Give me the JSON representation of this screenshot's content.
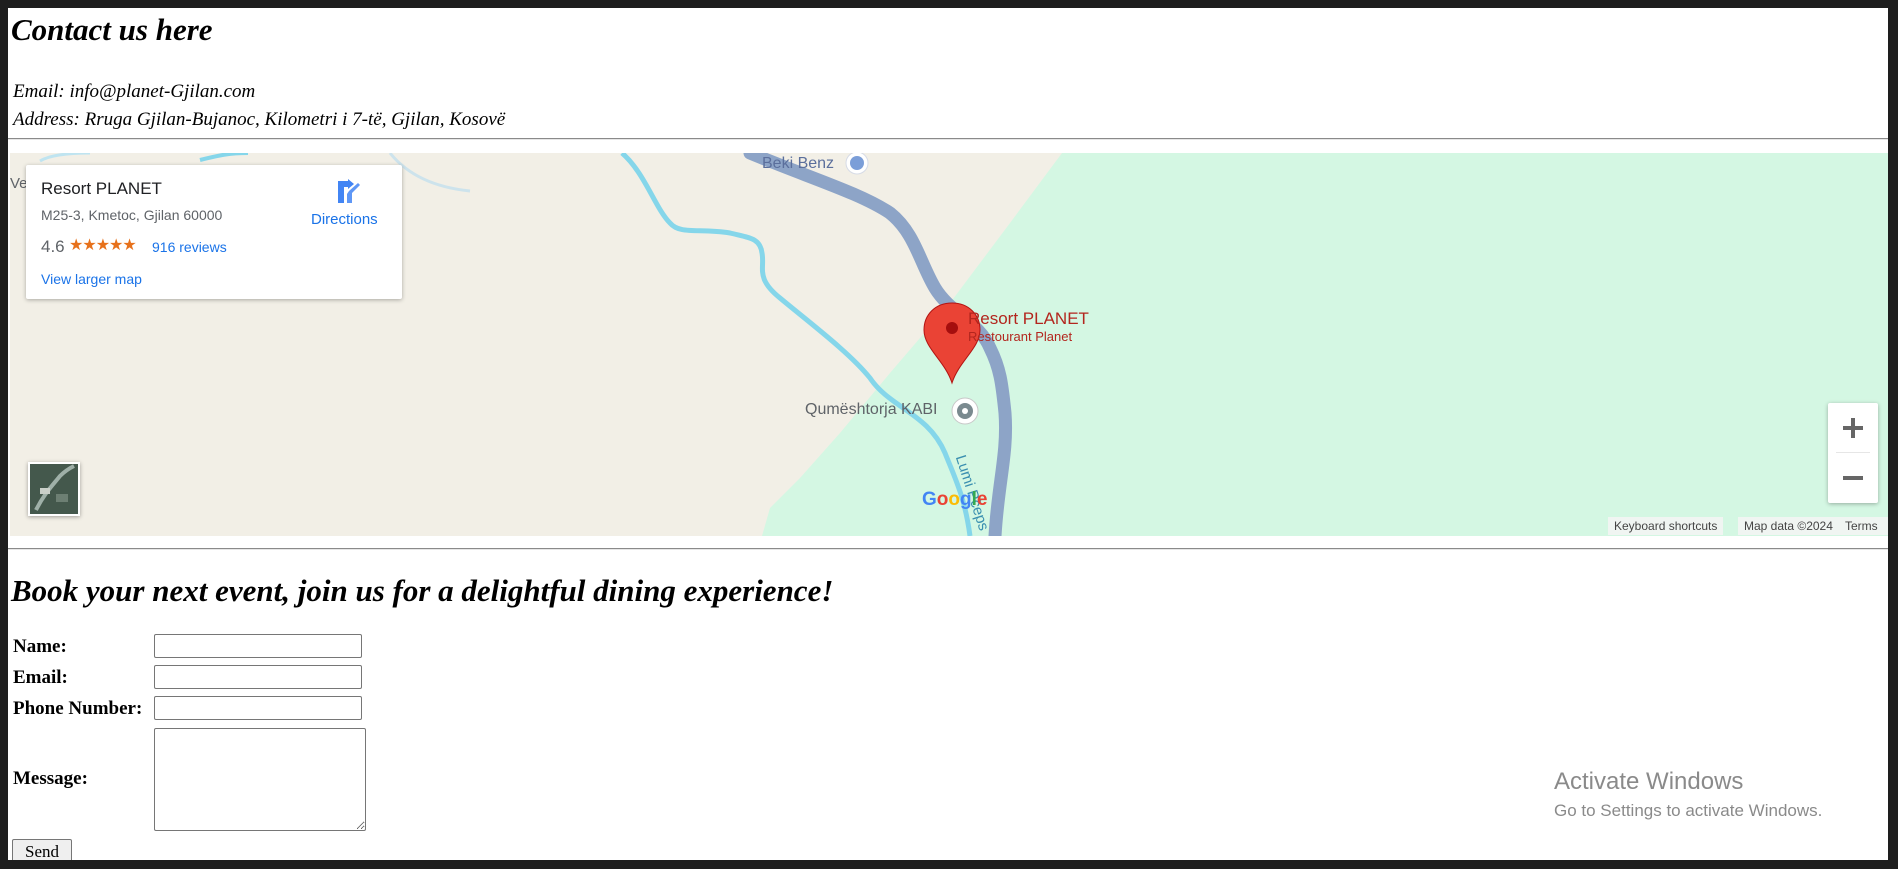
{
  "contact": {
    "title": "Contact us here",
    "email_line": "Email: info@planet-Gjilan.com",
    "address_line": "Address: Rruga Gjilan-Bujanoc, Kilometri i 7-të, Gjilan, Kosovë"
  },
  "map": {
    "place_card": {
      "name": "Resort PLANET",
      "address": "M25-3, Kmetoc, Gjilan 60000",
      "rating": "4.6",
      "stars_icon": "star-rating-icon",
      "reviews": "916 reviews",
      "view_larger": "View larger map",
      "directions": "Directions"
    },
    "labels": {
      "beki_benz": "Beki Benz",
      "resort_name": "Resort PLANET",
      "resort_sub": "Restourant Planet",
      "kabi": "Qumështorja KABI",
      "river": "Lumi Pčeps",
      "edge": "Ve"
    },
    "google": [
      "G",
      "o",
      "o",
      "g",
      "l",
      "e"
    ],
    "attribution": {
      "shortcuts": "Keyboard shortcuts",
      "data": "Map data ©2024",
      "terms": "Terms"
    },
    "zoom_in": "+",
    "zoom_out": "−",
    "colors": {
      "land": "#f2efe6",
      "forest": "#d4f7e3",
      "road": "#8da4c7",
      "river": "#85d6ea",
      "pin": "#ea4335",
      "resort_text": "#b3261e"
    }
  },
  "booking": {
    "title": "Book your next event, join us for a delightful dining experience!",
    "name_label": "Name:",
    "email_label": "Email:",
    "phone_label": "Phone Number:",
    "message_label": "Message:",
    "send_label": "Send"
  },
  "watermark": {
    "title": "Activate Windows",
    "subtitle": "Go to Settings to activate Windows."
  }
}
